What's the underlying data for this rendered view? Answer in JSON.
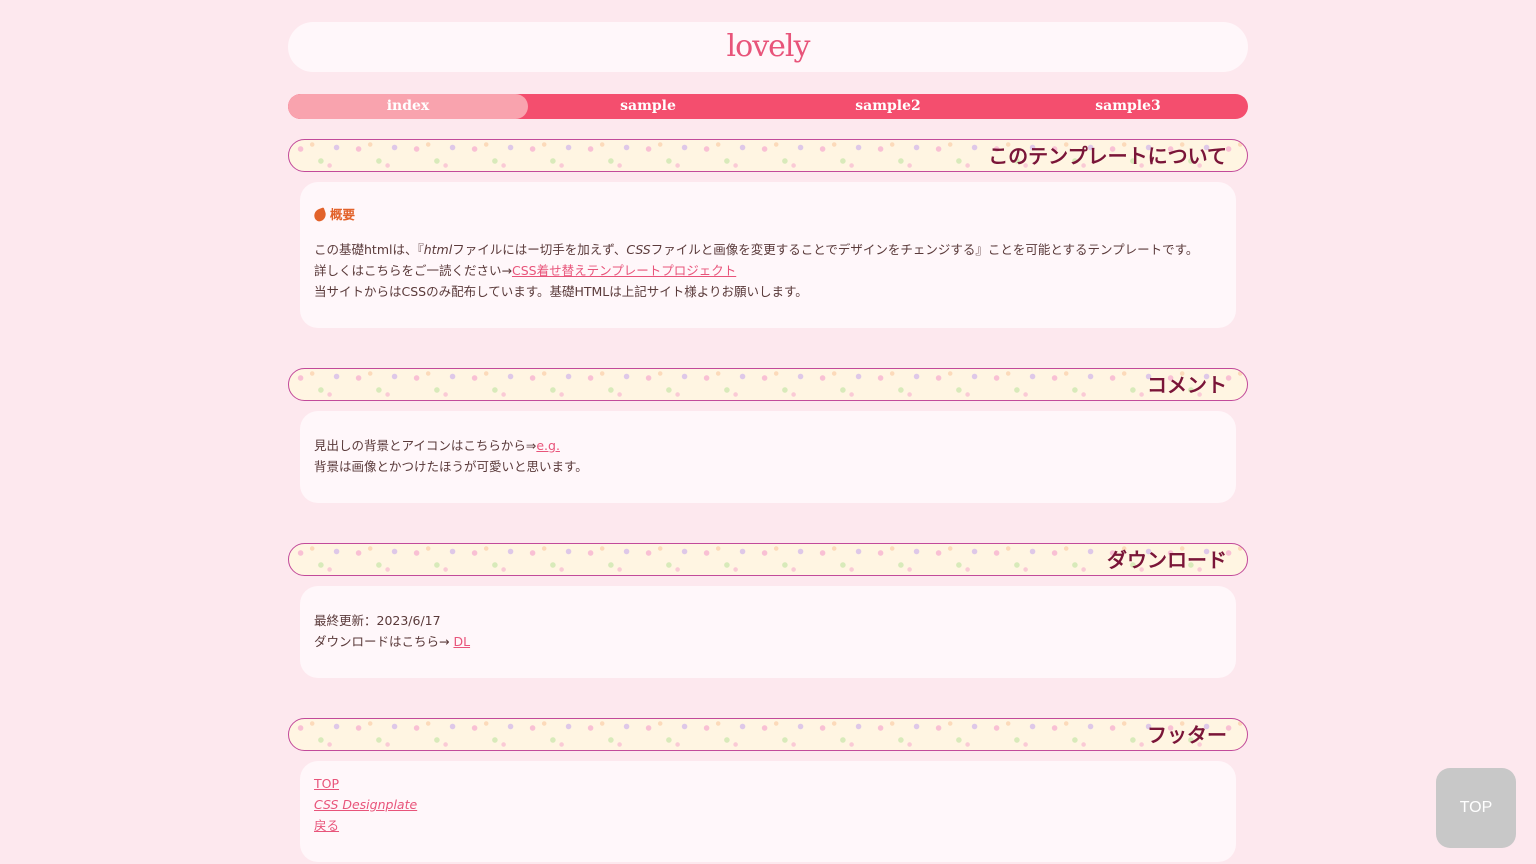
{
  "site": {
    "title": "lovely"
  },
  "nav": [
    {
      "label": "index",
      "active": true
    },
    {
      "label": "sample",
      "active": false
    },
    {
      "label": "sample2",
      "active": false
    },
    {
      "label": "sample3",
      "active": false
    }
  ],
  "sections": {
    "about": {
      "heading": "このテンプレートについて",
      "subhead": "概要",
      "line1_a": "この基礎htmlは、『",
      "line1_em1": "html",
      "line1_b": "ファイルにはー切手を加えず、",
      "line1_em2": "CSS",
      "line1_c": "ファイルと画像を変更することでデザインをチェンジする』ことを可能とするテンプレートです。",
      "line2_text": "詳しくはこちらをご一読ください→",
      "line2_link": "CSS着せ替えテンプレートプロジェクト",
      "line3": "当サイトからはCSSのみ配布しています。基礎HTMLは上記サイト様よりお願いします。"
    },
    "comment": {
      "heading": "コメント",
      "line1_text": "見出しの背景とアイコンはこちらから⇒",
      "line1_link": "e.g.",
      "line2": "背景は画像とかつけたほうが可愛いと思います。"
    },
    "download": {
      "heading": "ダウンロード",
      "updated": "最終更新：2023/6/17",
      "dl_text": "ダウンロードはこちら→ ",
      "dl_link": "DL"
    },
    "footer": {
      "heading": "フッター",
      "links": [
        "TOP",
        "CSS Designplate",
        "戻る"
      ]
    }
  },
  "top_button": "TOP",
  "colors": {
    "background": "#fde8ee",
    "accent": "#f44e6e",
    "nav_active": "#f9a3ae",
    "heading_text": "#7a1538",
    "link": "#e8547a"
  }
}
